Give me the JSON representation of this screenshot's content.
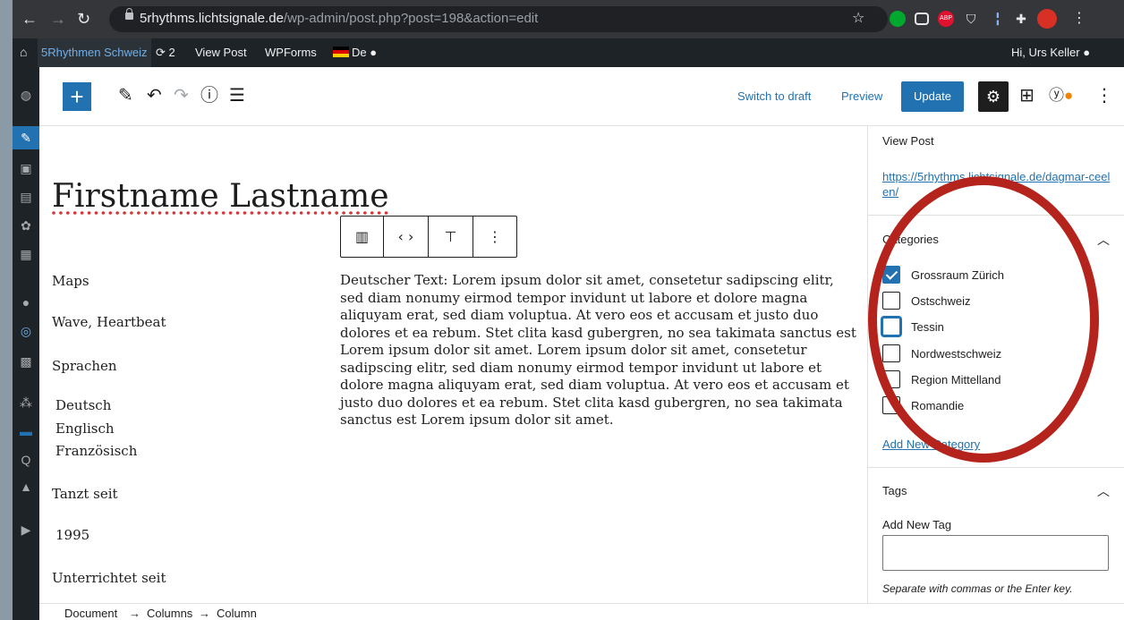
{
  "browser": {
    "url_host": "5rhythms.lichtsignale.de",
    "url_path": "/wp-admin/post.php?post=198&action=edit",
    "extensions": [
      "star-icon",
      "evernote-icon",
      "pocket-icon",
      "adblock-icon",
      "shield-icon",
      "bar-icon",
      "puzzle-icon",
      "profile-icon",
      "menu-icon"
    ]
  },
  "adminbar": {
    "site_name": "5Rhythmen Schweiz",
    "updates_count": "2",
    "view_post": "View Post",
    "wpforms": "WPForms",
    "language": "De",
    "greeting": "Hi, Urs Keller"
  },
  "toolbar": {
    "add_label": "+",
    "switch_to_draft": "Switch to draft",
    "preview": "Preview",
    "update": "Update"
  },
  "editor": {
    "title": "Firstname Lastname",
    "left_column": [
      "Maps",
      "Wave, Heartbeat",
      "Sprachen",
      "Deutsch",
      "Englisch",
      "Französisch",
      "Tanzt seit",
      "1995",
      "Unterrichtet seit"
    ],
    "body_text": "Deutscher Text: Lorem ipsum dolor sit amet, consetetur sadipscing elitr, sed diam nonumy eirmod tempor invidunt ut labore et dolore magna aliquyam erat, sed diam voluptua. At vero eos et accusam et justo duo dolores et ea rebum. Stet clita kasd gubergren, no sea takimata sanctus est Lorem ipsum dolor sit amet. Lorem ipsum dolor sit amet, consetetur sadipscing elitr, sed diam nonumy eirmod tempor invidunt ut labore et dolore magna aliquyam erat, sed diam voluptua. At vero eos et accusam et justo duo dolores et ea rebum. Stet clita kasd gubergren, no sea takimata sanctus est Lorem ipsum dolor sit amet."
  },
  "panel": {
    "view_post": "View Post",
    "permalink": "https://5rhythms.lichtsignale.de/dagmar-ceelen/",
    "categories_heading": "Categories",
    "categories": [
      {
        "label": "Grossraum Zürich",
        "checked": true
      },
      {
        "label": "Ostschweiz",
        "checked": false
      },
      {
        "label": "Tessin",
        "checked": false
      },
      {
        "label": "Nordwestschweiz",
        "checked": false
      },
      {
        "label": "Region Mittelland",
        "checked": false
      },
      {
        "label": "Romandie",
        "checked": false
      }
    ],
    "add_new_category": "Add New Category",
    "tags_heading": "Tags",
    "add_new_tag": "Add New Tag",
    "tag_help": "Separate with commas or the Enter key."
  },
  "breadcrumb": {
    "items": [
      "Document",
      "Columns",
      "Column"
    ],
    "separator": "→"
  },
  "colors": {
    "accent": "#2271b1",
    "annotation": "#b5241c",
    "adminbar": "#1d2327"
  }
}
